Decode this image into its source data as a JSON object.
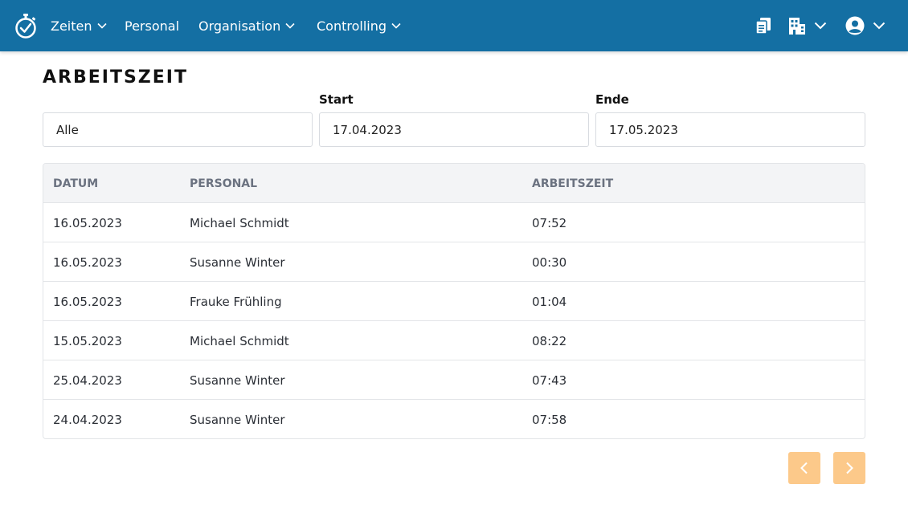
{
  "nav": {
    "items": [
      {
        "label": "Zeiten",
        "has_dropdown": true
      },
      {
        "label": "Personal",
        "has_dropdown": false
      },
      {
        "label": "Organisation",
        "has_dropdown": true
      },
      {
        "label": "Controlling",
        "has_dropdown": true
      }
    ],
    "right_icons": [
      "documents-icon",
      "building-icon",
      "user-avatar-icon"
    ]
  },
  "page": {
    "title": "ARBEITSZEIT"
  },
  "filters": {
    "staff": {
      "value": "Alle"
    },
    "start": {
      "label": "Start",
      "value": "17.04.2023"
    },
    "end": {
      "label": "Ende",
      "value": "17.05.2023"
    }
  },
  "table": {
    "headers": [
      "DATUM",
      "PERSONAL",
      "ARBEITSZEIT"
    ],
    "rows": [
      {
        "date": "16.05.2023",
        "person": "Michael Schmidt",
        "hours": "07:52"
      },
      {
        "date": "16.05.2023",
        "person": "Susanne Winter",
        "hours": "00:30"
      },
      {
        "date": "16.05.2023",
        "person": "Frauke Frühling",
        "hours": "01:04"
      },
      {
        "date": "15.05.2023",
        "person": "Michael Schmidt",
        "hours": "08:22"
      },
      {
        "date": "25.04.2023",
        "person": "Susanne Winter",
        "hours": "07:43"
      },
      {
        "date": "24.04.2023",
        "person": "Susanne Winter",
        "hours": "07:58"
      }
    ]
  },
  "colors": {
    "navbar": "#146fa3",
    "pager_button": "#fcc98a",
    "table_header_bg": "#f3f4f6"
  }
}
